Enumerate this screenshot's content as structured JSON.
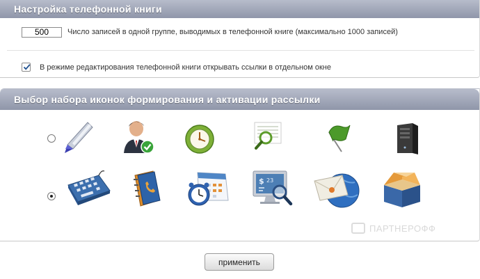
{
  "phonebook": {
    "title": "Настройка телефонной книги",
    "records_value": "500",
    "records_label": "Число записей в одной группе, выводимых в телефонной книге (максимально 1000 записей)",
    "open_links_label": "В режиме редактирования телефонной книги открывать ссылки в отдельном окне",
    "open_links_checked": true
  },
  "iconset": {
    "title": "Выбор набора иконок формирования и активации рассылки",
    "sets": [
      {
        "selected": false,
        "icons": [
          "pen-icon",
          "user-check-icon",
          "clock-icon",
          "magnifier-document-icon",
          "green-flag-icon",
          "server-tower-icon"
        ]
      },
      {
        "selected": true,
        "icons": [
          "keyboard-icon",
          "address-book-icon",
          "calendar-clock-icon",
          "monitor-magnifier-icon",
          "mail-globe-icon",
          "open-box-icon"
        ]
      }
    ]
  },
  "watermark": "ПАРТНЕРОФФ",
  "apply_label": "применить",
  "colors": {
    "header_top": "#b7bccb",
    "header_bottom": "#8f96a9"
  }
}
